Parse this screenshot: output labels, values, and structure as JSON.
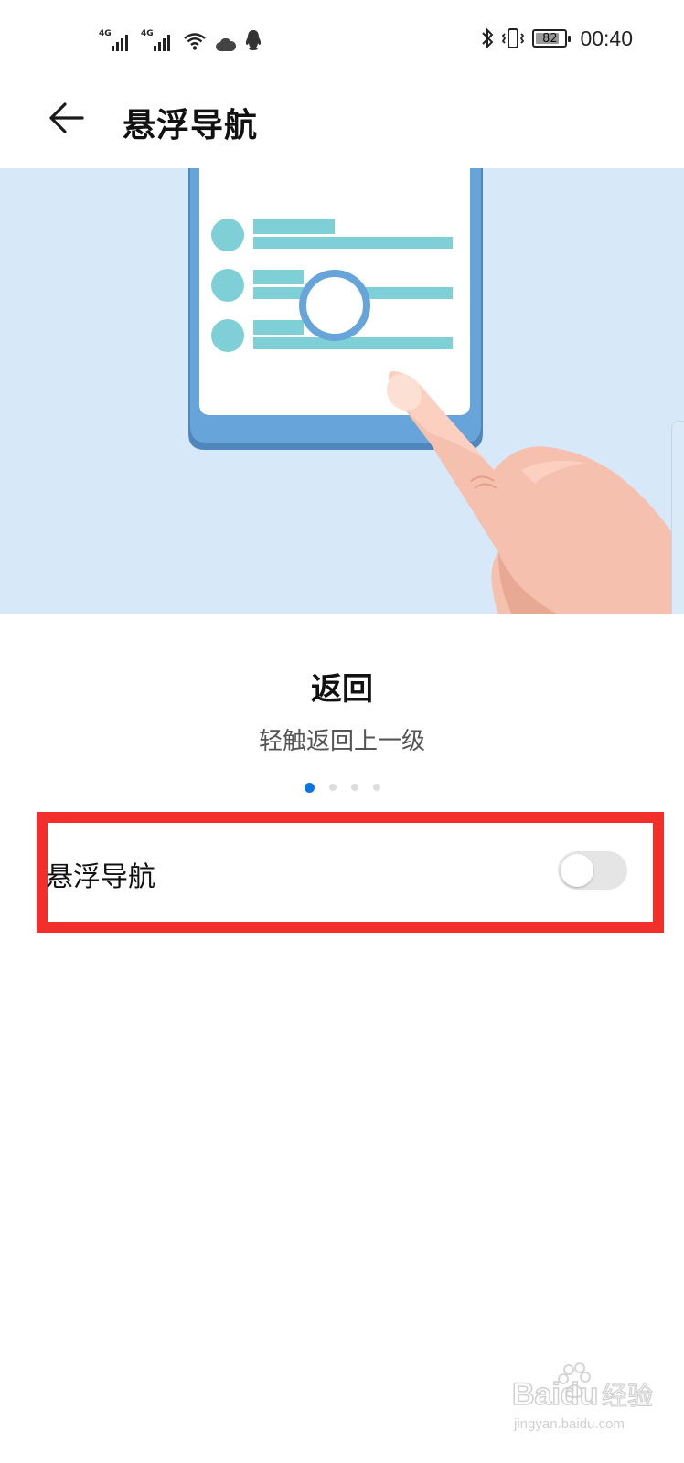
{
  "status_bar": {
    "signal1_label": "4G",
    "signal2_label": "4G",
    "battery_percent": "82",
    "battery_level": 0.82,
    "time": "00:40",
    "icons": [
      "signal-4g-icon",
      "signal-4g-icon",
      "wifi-icon",
      "cloud-icon",
      "qq-icon",
      "bluetooth-icon",
      "vibrate-icon",
      "battery-icon"
    ]
  },
  "header": {
    "back_icon": "arrow-left-icon",
    "title": "悬浮导航"
  },
  "tutorial": {
    "title": "返回",
    "description": "轻触返回上一级",
    "page_count": 4,
    "current_page": 1
  },
  "setting": {
    "label": "悬浮导航",
    "enabled": false
  },
  "colors": {
    "illustration_bg": "#d7e9f8",
    "phone_frame": "#66a4d9",
    "content_teal": "#7fd0d6",
    "accent_blue": "#0a74e0",
    "highlight_red": "#f32f2c",
    "toggle_off": "#e5e5e5"
  },
  "watermark": {
    "text": "Baidu经验",
    "subtext": "jingyan.baidu.com"
  }
}
